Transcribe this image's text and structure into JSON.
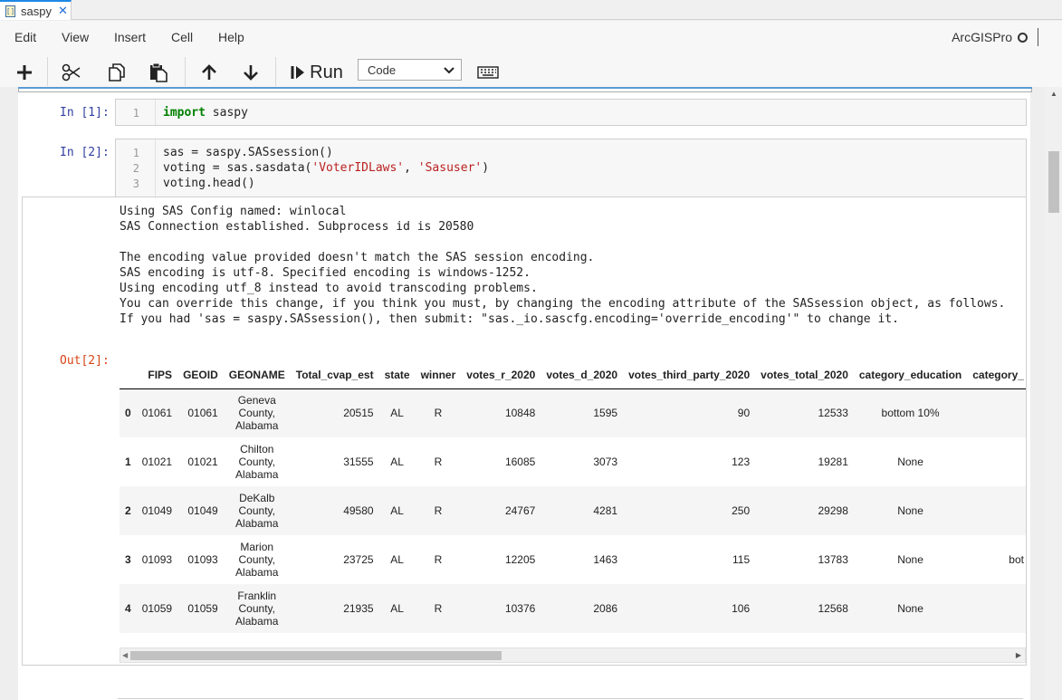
{
  "tab": {
    "icon_label": "[]",
    "title": "saspy",
    "close": "✕"
  },
  "menu": {
    "items": [
      "Edit",
      "View",
      "Insert",
      "Cell",
      "Help"
    ],
    "kernel_name": "ArcGISPro"
  },
  "toolbar": {
    "add": "add-cell-icon",
    "cut": "scissors-icon",
    "copy": "copy-icon",
    "paste": "paste-icon",
    "move_up": "arrow-up-icon",
    "move_down": "arrow-down-icon",
    "run_label": "Run",
    "cell_type": "Code",
    "keyboard": "keyboard-icon"
  },
  "cells": [
    {
      "prompt": "In [1]:",
      "lines": [
        "1"
      ]
    },
    {
      "prompt": "In [2]:",
      "lines": [
        "1",
        "2",
        "3"
      ]
    }
  ],
  "cell1_code": {
    "kw": "import",
    "rest": " saspy"
  },
  "cell2_code": {
    "l1": "sas = saspy.SASsession()",
    "l2a": "voting = sas.sasdata(",
    "l2s1": "'VoterIDLaws'",
    "l2b": ", ",
    "l2s2": "'Sasuser'",
    "l2c": ")",
    "l3": "voting.head()"
  },
  "stdout": "Using SAS Config named: winlocal\nSAS Connection established. Subprocess id is 20580\n\nThe encoding value provided doesn't match the SAS session encoding.\nSAS encoding is utf-8. Specified encoding is windows-1252.\nUsing encoding utf_8 instead to avoid transcoding problems.\nYou can override this change, if you think you must, by changing the encoding attribute of the SASsession object, as follows.\nIf you had 'sas = saspy.SASsession(), then submit: \"sas._io.sascfg.encoding='override_encoding'\" to change it.",
  "out_prompt": "Out[2]:",
  "table": {
    "columns": [
      "",
      "FIPS",
      "GEOID",
      "GEONAME",
      "Total_cvap_est",
      "state",
      "winner",
      "votes_r_2020",
      "votes_d_2020",
      "votes_third_party_2020",
      "votes_total_2020",
      "category_education",
      "category_"
    ],
    "rows": [
      [
        "0",
        "01061",
        "01061",
        "Geneva County, Alabama",
        "20515",
        "AL",
        "R",
        "10848",
        "1595",
        "90",
        "12533",
        "bottom 10%",
        ""
      ],
      [
        "1",
        "01021",
        "01021",
        "Chilton County, Alabama",
        "31555",
        "AL",
        "R",
        "16085",
        "3073",
        "123",
        "19281",
        "None",
        ""
      ],
      [
        "2",
        "01049",
        "01049",
        "DeKalb County, Alabama",
        "49580",
        "AL",
        "R",
        "24767",
        "4281",
        "250",
        "29298",
        "None",
        ""
      ],
      [
        "3",
        "01093",
        "01093",
        "Marion County, Alabama",
        "23725",
        "AL",
        "R",
        "12205",
        "1463",
        "115",
        "13783",
        "None",
        "bot"
      ],
      [
        "4",
        "01059",
        "01059",
        "Franklin County, Alabama",
        "21935",
        "AL",
        "R",
        "10376",
        "2086",
        "106",
        "12568",
        "None",
        ""
      ]
    ]
  },
  "colors": {
    "prompt_in": "#303f9f",
    "prompt_out": "#d84315",
    "keyword": "#008000",
    "string": "#ba2121",
    "accent": "#1e88e5"
  }
}
